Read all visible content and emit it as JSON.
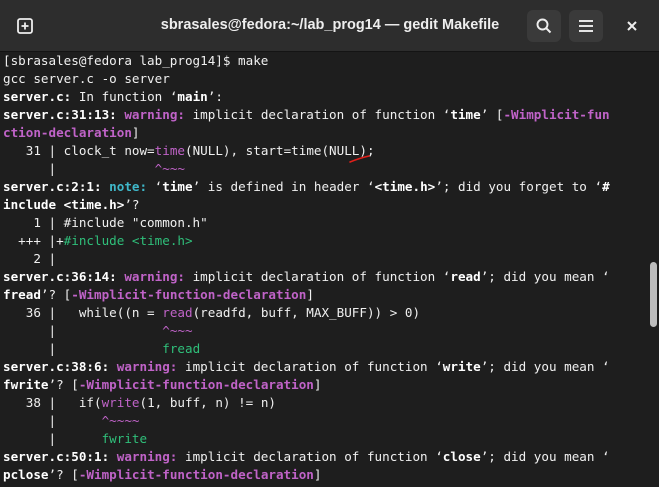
{
  "window": {
    "title": "sbrasales@fedora:~/lab_prog14 — gedit Makefile"
  },
  "icons": {
    "new_tab": "new-tab-icon",
    "search": "search-icon",
    "menu": "hamburger-menu-icon",
    "close": "close-icon"
  },
  "terminal": {
    "lines": [
      [
        {
          "t": "[sbrasales@fedora lab_prog14]$ make",
          "c": ""
        }
      ],
      [
        {
          "t": "gcc server.c -o server",
          "c": ""
        }
      ],
      [
        {
          "t": "server.c:",
          "c": "b"
        },
        {
          "t": " In function ‘",
          "c": ""
        },
        {
          "t": "main",
          "c": "b"
        },
        {
          "t": "’:",
          "c": ""
        }
      ],
      [
        {
          "t": "server.c:31:13: ",
          "c": "b"
        },
        {
          "t": "warning: ",
          "c": "w"
        },
        {
          "t": "implicit declaration of function ‘",
          "c": ""
        },
        {
          "t": "time",
          "c": "b"
        },
        {
          "t": "’ [",
          "c": ""
        },
        {
          "t": "-Wimplicit-fun",
          "c": "flag"
        }
      ],
      [
        {
          "t": "ction-declaration",
          "c": "flag"
        },
        {
          "t": "]",
          "c": ""
        }
      ],
      [
        {
          "t": "   31 | clock_t now=",
          "c": ""
        },
        {
          "t": "time",
          "c": "m"
        },
        {
          "t": "(NULL), start=time(NULL);",
          "c": ""
        }
      ],
      [
        {
          "t": "      |             ",
          "c": ""
        },
        {
          "t": "^~~~",
          "c": "m"
        }
      ],
      [
        {
          "t": "server.c:2:1: ",
          "c": "b"
        },
        {
          "t": "note: ",
          "c": "n"
        },
        {
          "t": "‘",
          "c": ""
        },
        {
          "t": "time",
          "c": "b"
        },
        {
          "t": "’ is defined in header ‘",
          "c": ""
        },
        {
          "t": "<time.h>",
          "c": "b"
        },
        {
          "t": "’; did you forget to ‘",
          "c": ""
        },
        {
          "t": "#",
          "c": "b"
        }
      ],
      [
        {
          "t": "include <time.h>",
          "c": "b"
        },
        {
          "t": "’?",
          "c": ""
        }
      ],
      [
        {
          "t": "    1 | #include \"common.h\"",
          "c": ""
        }
      ],
      [
        {
          "t": "  +++ |+",
          "c": ""
        },
        {
          "t": "#include <time.h>",
          "c": "g"
        }
      ],
      [
        {
          "t": "    2 |",
          "c": ""
        }
      ],
      [
        {
          "t": "server.c:36:14: ",
          "c": "b"
        },
        {
          "t": "warning: ",
          "c": "w"
        },
        {
          "t": "implicit declaration of function ‘",
          "c": ""
        },
        {
          "t": "read",
          "c": "b"
        },
        {
          "t": "’; did you mean ‘",
          "c": ""
        }
      ],
      [
        {
          "t": "fread",
          "c": "b"
        },
        {
          "t": "’? [",
          "c": ""
        },
        {
          "t": "-Wimplicit-function-declaration",
          "c": "flag"
        },
        {
          "t": "]",
          "c": ""
        }
      ],
      [
        {
          "t": "   36 |   while((n = ",
          "c": ""
        },
        {
          "t": "read",
          "c": "m"
        },
        {
          "t": "(readfd, buff, MAX_BUFF)) > 0)",
          "c": ""
        }
      ],
      [
        {
          "t": "      |              ",
          "c": ""
        },
        {
          "t": "^~~~",
          "c": "m"
        }
      ],
      [
        {
          "t": "      |              ",
          "c": ""
        },
        {
          "t": "fread",
          "c": "g"
        }
      ],
      [
        {
          "t": "server.c:38:6: ",
          "c": "b"
        },
        {
          "t": "warning: ",
          "c": "w"
        },
        {
          "t": "implicit declaration of function ‘",
          "c": ""
        },
        {
          "t": "write",
          "c": "b"
        },
        {
          "t": "’; did you mean ‘",
          "c": ""
        }
      ],
      [
        {
          "t": "fwrite",
          "c": "b"
        },
        {
          "t": "’? [",
          "c": ""
        },
        {
          "t": "-Wimplicit-function-declaration",
          "c": "flag"
        },
        {
          "t": "]",
          "c": ""
        }
      ],
      [
        {
          "t": "   38 |   if(",
          "c": ""
        },
        {
          "t": "write",
          "c": "m"
        },
        {
          "t": "(1, buff, n) != n)",
          "c": ""
        }
      ],
      [
        {
          "t": "      |      ",
          "c": ""
        },
        {
          "t": "^~~~~",
          "c": "m"
        }
      ],
      [
        {
          "t": "      |      ",
          "c": ""
        },
        {
          "t": "fwrite",
          "c": "g"
        }
      ],
      [
        {
          "t": "server.c:50:1: ",
          "c": "b"
        },
        {
          "t": "warning: ",
          "c": "w"
        },
        {
          "t": "implicit declaration of function ‘",
          "c": ""
        },
        {
          "t": "close",
          "c": "b"
        },
        {
          "t": "’; did you mean ‘",
          "c": ""
        }
      ],
      [
        {
          "t": "pclose",
          "c": "b"
        },
        {
          "t": "’? [",
          "c": ""
        },
        {
          "t": "-Wimplicit-function-declaration",
          "c": "flag"
        },
        {
          "t": "]",
          "c": ""
        }
      ]
    ]
  },
  "colors": {
    "background": "#1e1e1e",
    "titlebar": "#2d2d2d",
    "warning": "#c063c8",
    "note": "#3fb7c9",
    "fixit": "#2fbf7a",
    "annotation_stroke": "#e0201a"
  }
}
